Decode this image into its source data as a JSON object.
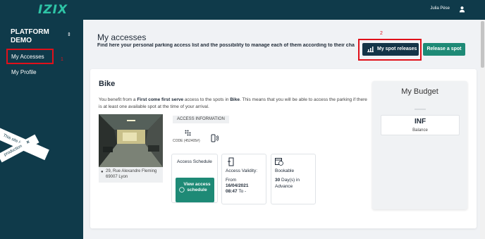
{
  "header": {
    "logo": "IZIX",
    "user_name": "Julia Pèse"
  },
  "sidebar": {
    "platform_line1": "PLATFORM",
    "platform_line2": "DEMO",
    "items": [
      {
        "label": "My Accesses"
      },
      {
        "label": "My Profile"
      }
    ],
    "production_banner_line1": "This site is not",
    "production_banner_line2": "production"
  },
  "annotations": {
    "marker_1": "1",
    "marker_2": "2"
  },
  "page": {
    "title": "My accesses",
    "subtitle": "Find here your personal parking access list and the possibility to manage each of them according to their cha",
    "spot_releases_button": "My spot releases",
    "release_spot_button": "Release a spot"
  },
  "access": {
    "name": "Bike",
    "desc_1": "You benefit from a ",
    "desc_bold_1": "First come first serve",
    "desc_2": " access to the spots in ",
    "desc_bold_2": "Bike",
    "desc_3": ". This means that you will be able to access the parking if there is at least one available spot at the time of your arrival.",
    "address": "29, Rue Alexandre Fleming 69007 Lyon",
    "info_tag": "ACCESS INFORMATION",
    "code": "CODE (452405#)",
    "schedule_label": "Access Schedule",
    "view_schedule_button": "View access schedule",
    "validity_label": "Access Validity:",
    "validity_from": "From",
    "validity_date": "16/04/2021",
    "validity_time": "08:47",
    "validity_to": "To -",
    "bookable_label": "Bookable",
    "bookable_days": "30",
    "bookable_suffix": "Day(s) in Advance"
  },
  "budget": {
    "title": "My Budget",
    "value": "INF",
    "label": "Balance"
  },
  "colors": {
    "sidebar_bg": "#0f3a4a",
    "accent_green": "#1e8a76",
    "logo_green": "#2ec4a6",
    "dark_button": "#143548",
    "annotation_red": "#e0101a"
  }
}
